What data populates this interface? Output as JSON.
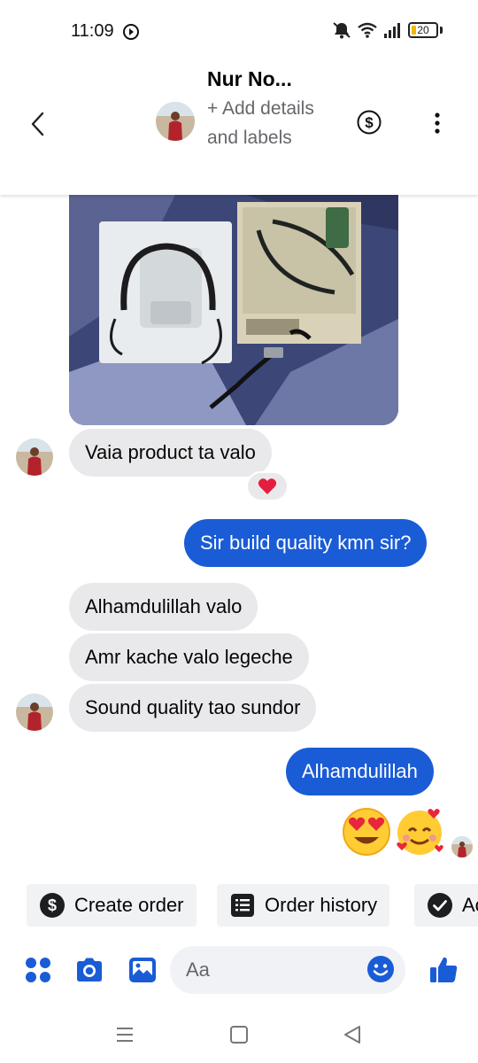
{
  "status_bar": {
    "time": "11:09",
    "battery_level": "20"
  },
  "header": {
    "contact_name": "Nur No...",
    "subtitle": "+ Add details and labels",
    "back_icon": "chevron-left-icon",
    "payment_icon": "dollar-circle-icon",
    "more_icon": "more-vertical-icon"
  },
  "messages": [
    {
      "direction": "incoming",
      "type": "image",
      "description_icon": "photo"
    },
    {
      "direction": "incoming",
      "type": "text",
      "text": "Vaia product ta valo",
      "reaction": "heart"
    },
    {
      "direction": "outgoing",
      "type": "text",
      "text": "Sir build quality kmn sir?"
    },
    {
      "direction": "incoming",
      "type": "text",
      "text": "Alhamdulillah valo"
    },
    {
      "direction": "incoming",
      "type": "text",
      "text": "Amr kache valo legeche"
    },
    {
      "direction": "incoming",
      "type": "text",
      "text": "Sound quality tao sundor"
    },
    {
      "direction": "outgoing",
      "type": "text",
      "text": "Alhamdulillah"
    },
    {
      "direction": "outgoing",
      "type": "emoji",
      "emojis": [
        "heart-eyes-emoji",
        "smiling-face-with-hearts-emoji"
      ]
    }
  ],
  "quick_actions": [
    {
      "label": "Create order",
      "icon": "dollar-circle-icon"
    },
    {
      "label": "Order history",
      "icon": "receipt-icon"
    },
    {
      "label": "Ac",
      "icon": "check-circle-icon"
    }
  ],
  "composer": {
    "placeholder": "Aa",
    "icons": [
      "apps-grid-icon",
      "camera-icon",
      "gallery-icon",
      "emoji-icon",
      "thumbs-up-icon"
    ]
  },
  "colors": {
    "accent": "#1a5cd6",
    "incoming_bubble": "#e9e9eb",
    "muted_text": "#65676b"
  }
}
